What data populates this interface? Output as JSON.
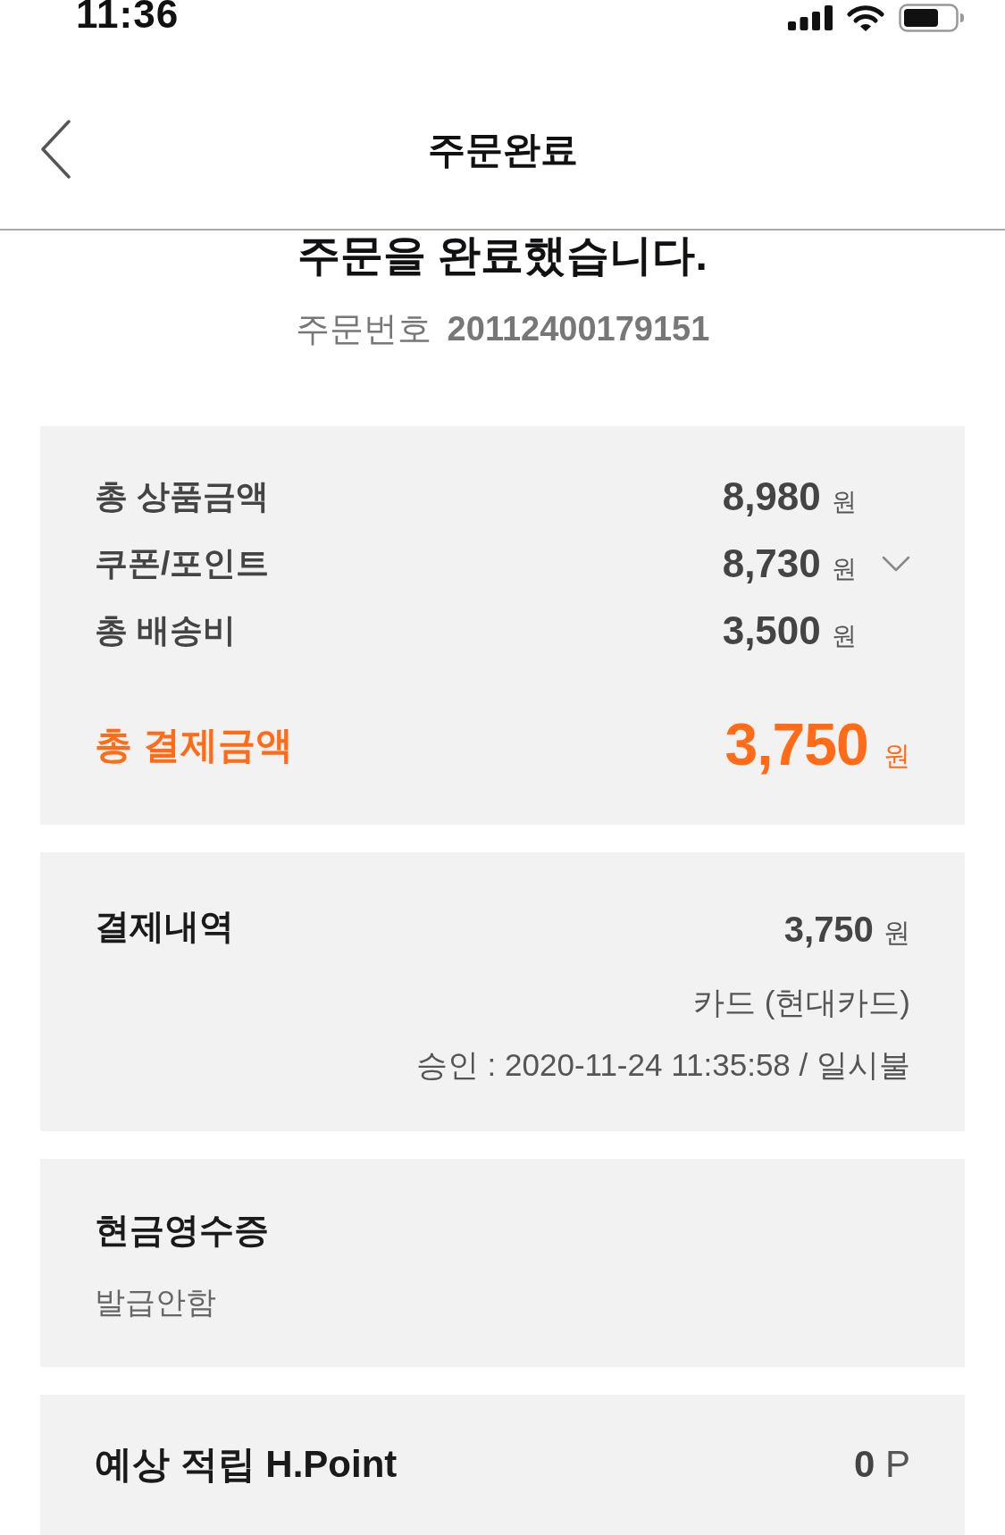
{
  "status_bar": {
    "time": "11:36"
  },
  "header": {
    "title": "주문완료"
  },
  "completion": {
    "message": "주문을 완료했습니다.",
    "order_number_label": "주문번호",
    "order_number": "20112400179151"
  },
  "summary": {
    "rows": [
      {
        "kind": "amount",
        "label": "총 상품금액",
        "amount": "8,980",
        "unit": "원"
      },
      {
        "kind": "expandable",
        "label": "쿠폰/포인트",
        "amount": "8,730",
        "unit": "원",
        "expanded": false
      },
      {
        "kind": "amount",
        "label": "총 배송비",
        "amount": "3,500",
        "unit": "원"
      }
    ],
    "total": {
      "label": "총 결제금액",
      "amount": "3,750",
      "unit": "원"
    }
  },
  "payment": {
    "title": "결제내역",
    "amount": "3,750",
    "unit": "원",
    "method": "카드 (현대카드)",
    "approval": "승인 : 2020-11-24 11:35:58 / 일시불"
  },
  "cash_receipt": {
    "title": "현금영수증",
    "status": "발급안함"
  },
  "points": {
    "title": "예상 적립 H.Point",
    "amount": "0",
    "unit": "P"
  }
}
